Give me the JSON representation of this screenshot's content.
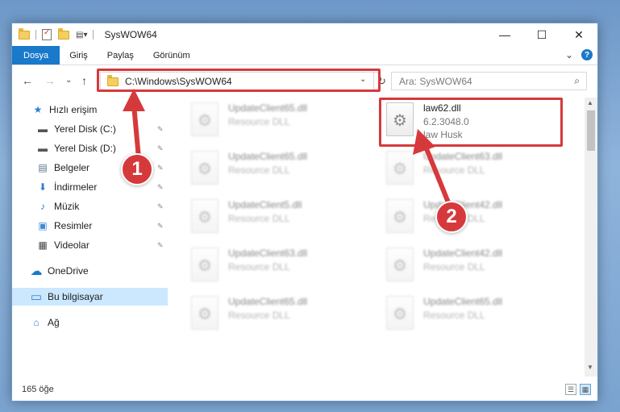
{
  "window": {
    "title": "SysWOW64",
    "controls": {
      "minimize": "—",
      "maximize": "☐",
      "close": "✕"
    }
  },
  "ribbon": {
    "tabs": [
      "Dosya",
      "Giriş",
      "Paylaş",
      "Görünüm"
    ],
    "expand": "⌄",
    "help": "?"
  },
  "nav": {
    "back": "←",
    "forward": "→",
    "recent": "⌄",
    "up": "↑"
  },
  "address": {
    "path": "C:\\Windows\\SysWOW64",
    "dropdown": "⌄",
    "refresh": "↻"
  },
  "search": {
    "placeholder": "Ara: SysWOW64",
    "icon": "⌕"
  },
  "sidebar": {
    "items": [
      {
        "label": "Hızlı erişim",
        "icon": "star-icon",
        "glyph": "★",
        "color": "#2a7fd4"
      },
      {
        "label": "Yerel Disk (C:)",
        "icon": "drive-icon",
        "glyph": "▬",
        "color": "#555"
      },
      {
        "label": "Yerel Disk (D:)",
        "icon": "drive-icon",
        "glyph": "▬",
        "color": "#555"
      },
      {
        "label": "Belgeler",
        "icon": "documents-icon",
        "glyph": "▤",
        "color": "#5a6f8c"
      },
      {
        "label": "İndirmeler",
        "icon": "download-icon",
        "glyph": "⬇",
        "color": "#2a7fd4"
      },
      {
        "label": "Müzik",
        "icon": "music-icon",
        "glyph": "♪",
        "color": "#2a7fd4"
      },
      {
        "label": "Resimler",
        "icon": "pictures-icon",
        "glyph": "▣",
        "color": "#3f8ad8"
      },
      {
        "label": "Videolar",
        "icon": "videos-icon",
        "glyph": "▦",
        "color": "#444"
      },
      {
        "label": "OneDrive",
        "icon": "cloud-icon",
        "glyph": "☁",
        "color": "#1979ca"
      },
      {
        "label": "Bu bilgisayar",
        "icon": "computer-icon",
        "glyph": "▭",
        "color": "#2a7fd4"
      },
      {
        "label": "Ağ",
        "icon": "network-icon",
        "glyph": "⌂",
        "color": "#2a7fd4"
      }
    ],
    "pin": "✎"
  },
  "files": {
    "highlighted": {
      "name": "law62.dll",
      "version": "6.2.3048.0",
      "description": "law Husk"
    },
    "left_column": [
      {
        "name": "UpdateClient65.dll",
        "type": "Resource DLL"
      },
      {
        "name": "UpdateClient65.dll",
        "type": "Resource DLL"
      },
      {
        "name": "UpdateClient5.dll",
        "type": "Resource DLL"
      },
      {
        "name": "UpdateClient63.dll",
        "type": "Resource DLL"
      },
      {
        "name": "UpdateClient65.dll",
        "type": "Resource DLL"
      }
    ],
    "right_column": [
      {
        "name": "UpdateClient63.dll",
        "type": "Resource DLL"
      },
      {
        "name": "UpdateClient42.dll",
        "type": "Resource DLL"
      },
      {
        "name": "UpdateClient42.dll",
        "type": "Resource DLL"
      },
      {
        "name": "UpdateClient65.dll",
        "type": "Resource DLL"
      }
    ]
  },
  "status": {
    "count": "165 öğe"
  },
  "annotations": {
    "step1": "1",
    "step2": "2",
    "accent": "#d6393c"
  }
}
